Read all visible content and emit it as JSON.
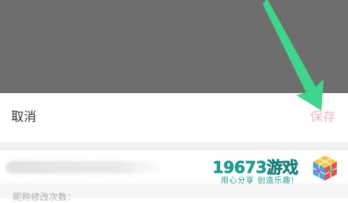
{
  "header": {
    "cancel_label": "取消",
    "save_label": "保存"
  },
  "hint": {
    "text": "昵称修改次数："
  },
  "watermark": {
    "brand": "19673游戏",
    "slogan": "用心分享 创造乐趣!"
  },
  "colors": {
    "overlay": "#6e6e6e",
    "save_disabled": "#f2b8bf",
    "arrow": "#3dd68c",
    "watermark": "#1aa39a"
  }
}
